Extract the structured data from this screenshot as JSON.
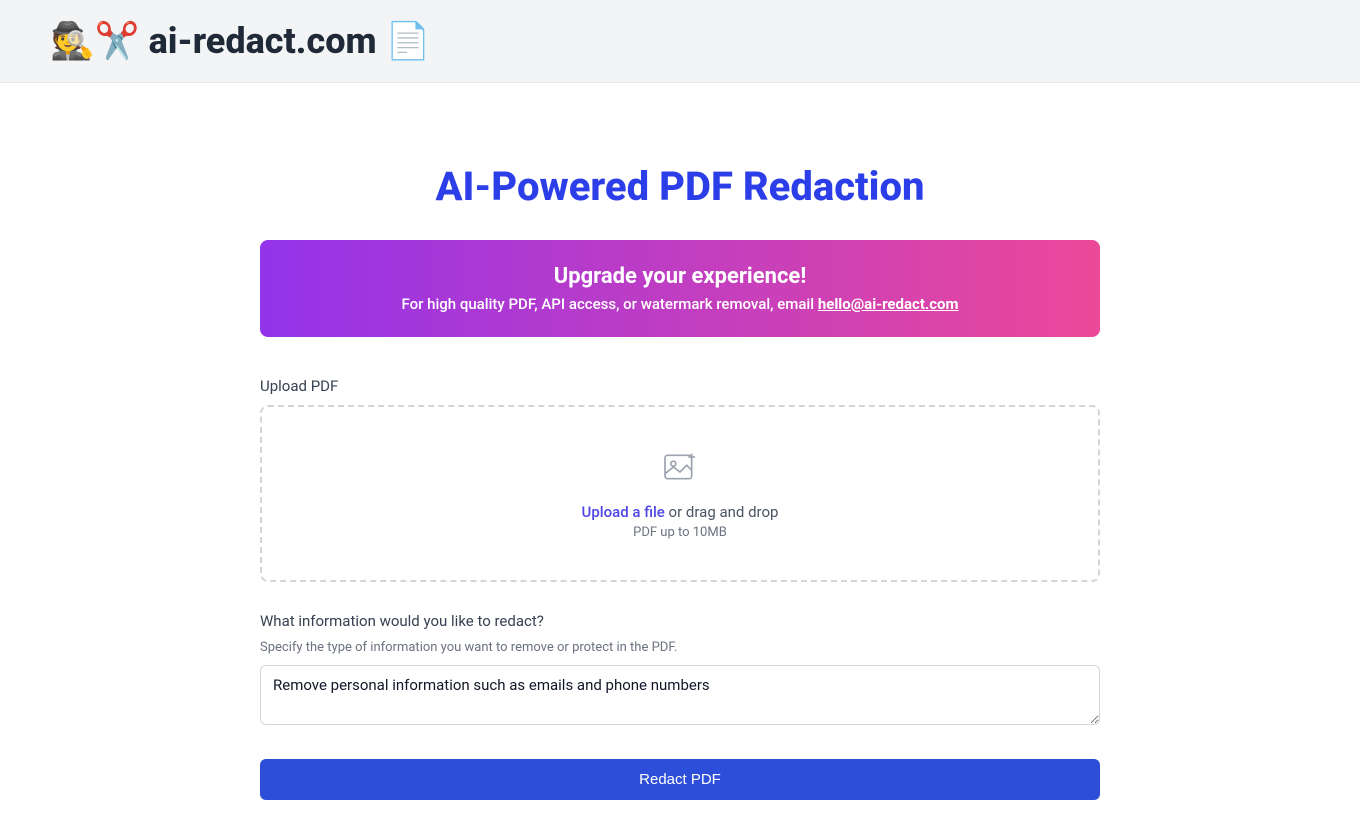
{
  "header": {
    "title": "🕵️✂️ ai-redact.com 📄"
  },
  "main": {
    "title": "AI-Powered PDF Redaction"
  },
  "banner": {
    "title": "Upgrade your experience!",
    "text_prefix": "For high quality PDF, API access, or watermark removal, email ",
    "email": "hello@ai-redact.com"
  },
  "upload": {
    "label": "Upload PDF",
    "link_text": "Upload a file",
    "drag_text": " or drag and drop",
    "hint": "PDF up to 10MB"
  },
  "prompt": {
    "label": "What information would you like to redact?",
    "sub_label": "Specify the type of information you want to remove or protect in the PDF.",
    "placeholder": "Remove personal information such as emails and phone numbers"
  },
  "submit": {
    "label": "Redact PDF"
  }
}
